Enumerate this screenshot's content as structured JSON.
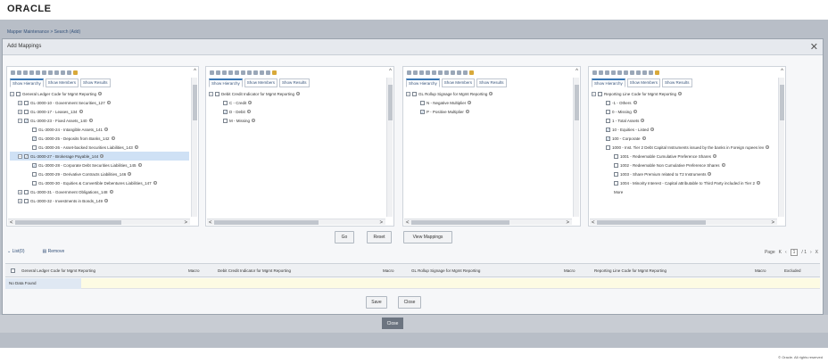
{
  "brand": "ORACLE",
  "breadcrumb": "Mapper Maintenance > Search (Add)",
  "modal": {
    "title": "Add Mappings",
    "close_symbol": "✕"
  },
  "tabs": [
    "Show Hierarchy",
    "Show Members",
    "Show Results"
  ],
  "panels": [
    {
      "nodes": [
        {
          "level": 0,
          "exp": "−",
          "checked": false,
          "label": "General Ledger Code for Mgmt Reporting",
          "sel": false
        },
        {
          "level": 1,
          "exp": "+",
          "checked": false,
          "label": "GL-3000-10 - Government Securities_127",
          "sel": false
        },
        {
          "level": 1,
          "exp": "+",
          "checked": false,
          "label": "GL-3000-17 - Leases_134",
          "sel": false
        },
        {
          "level": 1,
          "exp": "−",
          "checked": true,
          "label": "GL-3000-23 - Fixed Assets_140",
          "sel": false
        },
        {
          "level": 2,
          "exp": "",
          "checked": false,
          "label": "GL-3000-24 - Intangible Assets_141",
          "sel": false
        },
        {
          "level": 2,
          "exp": "",
          "checked": true,
          "label": "GL-3000-25 - Deposits from Banks_142",
          "sel": false
        },
        {
          "level": 2,
          "exp": "",
          "checked": false,
          "label": "GL-3000-26 - Asset-backed Securities Liabilities_143",
          "sel": false
        },
        {
          "level": 1,
          "exp": "−",
          "checked": true,
          "label": "GL-3000-27 - Brokerage Payable_144",
          "sel": true
        },
        {
          "level": 2,
          "exp": "",
          "checked": true,
          "label": "GL-3000-28 - Corporate Debt Securities Liabilities_145",
          "sel": false
        },
        {
          "level": 2,
          "exp": "",
          "checked": false,
          "label": "GL-3000-29 - Derivative Contracts Liabilities_146",
          "sel": false
        },
        {
          "level": 2,
          "exp": "",
          "checked": false,
          "label": "GL-3000-30 - Equities & Convertible Debentures Liabilities_147",
          "sel": false
        },
        {
          "level": 1,
          "exp": "+",
          "checked": false,
          "label": "GL-3000-31 - Government Obligations_148",
          "sel": false
        },
        {
          "level": 1,
          "exp": "+",
          "checked": false,
          "label": "GL-3000-32 - Investments in Bonds_149",
          "sel": false
        }
      ]
    },
    {
      "nodes": [
        {
          "level": 0,
          "exp": "−",
          "checked": false,
          "label": "Debit Credit Indicator for Mgmt Reporting",
          "sel": false
        },
        {
          "level": 1,
          "exp": "",
          "checked": false,
          "label": "C - Credit",
          "sel": false
        },
        {
          "level": 1,
          "exp": "",
          "checked": true,
          "label": "D - Debit",
          "sel": false
        },
        {
          "level": 1,
          "exp": "",
          "checked": false,
          "label": "M - Missing",
          "sel": false
        }
      ]
    },
    {
      "nodes": [
        {
          "level": 0,
          "exp": "−",
          "checked": false,
          "label": "GL Rollup Signage for Mgmt Reporting",
          "sel": false
        },
        {
          "level": 1,
          "exp": "",
          "checked": false,
          "label": "N - Negative Multiplier",
          "sel": false
        },
        {
          "level": 1,
          "exp": "",
          "checked": true,
          "label": "P - Positive Multiplier",
          "sel": false
        }
      ]
    },
    {
      "nodes": [
        {
          "level": 0,
          "exp": "−",
          "checked": false,
          "label": "Reporting Line Code for Mgmt Reporting",
          "sel": false
        },
        {
          "level": 1,
          "exp": "",
          "checked": false,
          "label": "-1 - Others",
          "sel": false
        },
        {
          "level": 1,
          "exp": "",
          "checked": false,
          "label": "0 - Missing",
          "sel": false
        },
        {
          "level": 1,
          "exp": "",
          "checked": false,
          "label": "1 - Total Assets",
          "sel": false
        },
        {
          "level": 1,
          "exp": "",
          "checked": true,
          "label": "10 - Equities - Listed",
          "sel": false
        },
        {
          "level": 1,
          "exp": "",
          "checked": true,
          "label": "100 - Corporate",
          "sel": false
        },
        {
          "level": 1,
          "exp": "",
          "checked": false,
          "label": "1000 - Inst. Tier 2 Debt Capital Instruments issued by the banks in Foreign rupees lev",
          "sel": false
        },
        {
          "level": 2,
          "exp": "",
          "checked": false,
          "label": "1001 - Redeemable Cumulative Preference Shares",
          "sel": false
        },
        {
          "level": 2,
          "exp": "",
          "checked": false,
          "label": "1002 - Redeemable Non Cumulative Preference Shares",
          "sel": false
        },
        {
          "level": 2,
          "exp": "",
          "checked": false,
          "label": "1003 - Share Premium related to T2 Instruments",
          "sel": false
        },
        {
          "level": 2,
          "exp": "",
          "checked": false,
          "label": "1004 - Minority Interest - Capital attributable to Third Party included in Tier 2",
          "sel": false
        },
        {
          "level": 2,
          "exp": "",
          "checked": null,
          "label": "More",
          "sel": false
        }
      ]
    }
  ],
  "buttons": {
    "go": "Go",
    "reset": "Reset",
    "view": "View Mappings",
    "save": "Save",
    "close": "Close",
    "outer_close": "Close"
  },
  "list": {
    "title": "List(0)",
    "remove": "Remove",
    "pager_label": "Page",
    "page": "1",
    "of": "/ 1",
    "columns": [
      "General Ledger Code for Mgmt Reporting",
      "Macro",
      "Debit Credit Indicator for Mgmt Reporting",
      "Macro",
      "GL Rollup Signage for Mgmt Reporting",
      "Macro",
      "Reporting Line Code for Mgmt Reporting",
      "Macro",
      "Excluded"
    ],
    "empty": "No Data Found"
  },
  "footer": "© Oracle. All rights reserved"
}
